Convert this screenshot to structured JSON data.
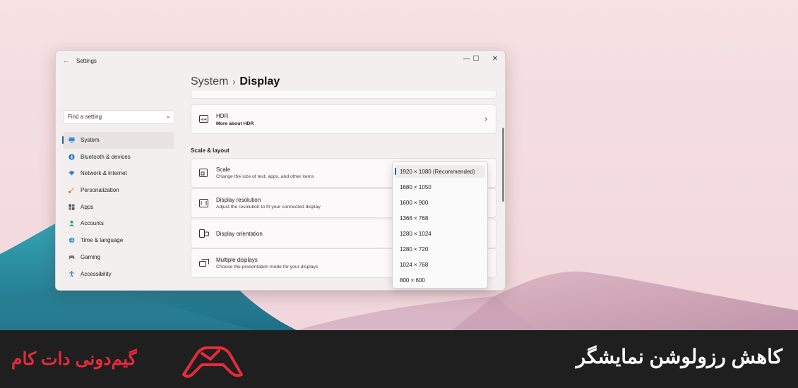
{
  "window": {
    "title": "Settings"
  },
  "search": {
    "placeholder": "Find a setting"
  },
  "sidebar": {
    "items": [
      {
        "label": "System",
        "icon": "monitor-icon"
      },
      {
        "label": "Bluetooth & devices",
        "icon": "bluetooth-icon"
      },
      {
        "label": "Network & internet",
        "icon": "wifi-icon"
      },
      {
        "label": "Personalization",
        "icon": "brush-icon"
      },
      {
        "label": "Apps",
        "icon": "apps-icon"
      },
      {
        "label": "Accounts",
        "icon": "person-icon"
      },
      {
        "label": "Time & language",
        "icon": "globe-icon"
      },
      {
        "label": "Gaming",
        "icon": "controller-icon"
      },
      {
        "label": "Accessibility",
        "icon": "accessibility-icon"
      }
    ]
  },
  "header": {
    "parent": "System",
    "separator": "›",
    "current": "Display"
  },
  "hdr": {
    "title": "HDR",
    "subtitle": "More about HDR",
    "badge": "HDR"
  },
  "section": {
    "title": "Scale & layout"
  },
  "settings": {
    "scale": {
      "title": "Scale",
      "subtitle": "Change the size of text, apps, and other items"
    },
    "resolution": {
      "title": "Display resolution",
      "subtitle": "Adjust the resolution to fit your connected display"
    },
    "orientation": {
      "title": "Display orientation"
    },
    "multiple": {
      "title": "Multiple displays",
      "subtitle": "Choose the presentation mode for your displays"
    }
  },
  "resolution_options": [
    "1920 × 1080 (Recommended)",
    "1680 × 1050",
    "1600 × 900",
    "1366 × 768",
    "1280 × 1024",
    "1280 × 720",
    "1024 × 768",
    "800 × 600"
  ],
  "selected_resolution": "1920 × 1080 (Recommended)",
  "banner": {
    "title": "کاهش رزولوشن نمایشگر",
    "brand": "گیم‌دونی دات کام"
  },
  "colors": {
    "accent": "#1f5fa0",
    "brand": "#e52b3b",
    "banner_bg": "#1f1f1f"
  }
}
